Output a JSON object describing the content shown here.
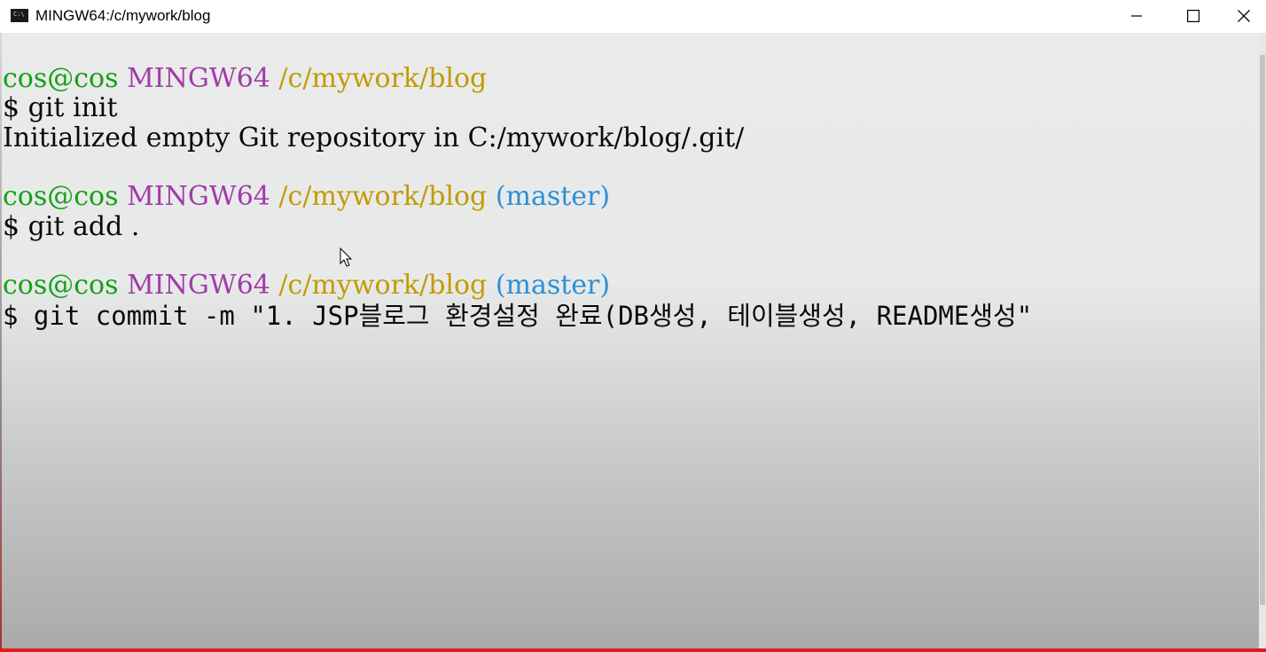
{
  "window": {
    "title": "MINGW64:/c/mywork/blog",
    "icon": "terminal-icon",
    "icon_glyph": "C:\\"
  },
  "controls": {
    "minimize": "minimize-icon",
    "maximize": "maximize-icon",
    "close": "close-icon"
  },
  "terminal": {
    "prompt1": {
      "user": "cos@cos",
      "host": "MINGW64",
      "path": "/c/mywork/blog"
    },
    "cmd1": "$ git init",
    "out1": "Initialized empty Git repository in C:/mywork/blog/.git/",
    "prompt2": {
      "user": "cos@cos",
      "host": "MINGW64",
      "path": "/c/mywork/blog",
      "branch": "(master)"
    },
    "cmd2": "$ git add .",
    "prompt3": {
      "user": "cos@cos",
      "host": "MINGW64",
      "path": "/c/mywork/blog",
      "branch": "(master)"
    },
    "cmd3": "$ git commit -m \"1. JSP블로그 환경설정 완료(DB생성, 테이블생성, README생성\""
  },
  "colors": {
    "user": "#17a017",
    "host": "#a23aa8",
    "path": "#c39a00",
    "branch": "#2d8fd7",
    "text": "#0a0a0a"
  }
}
